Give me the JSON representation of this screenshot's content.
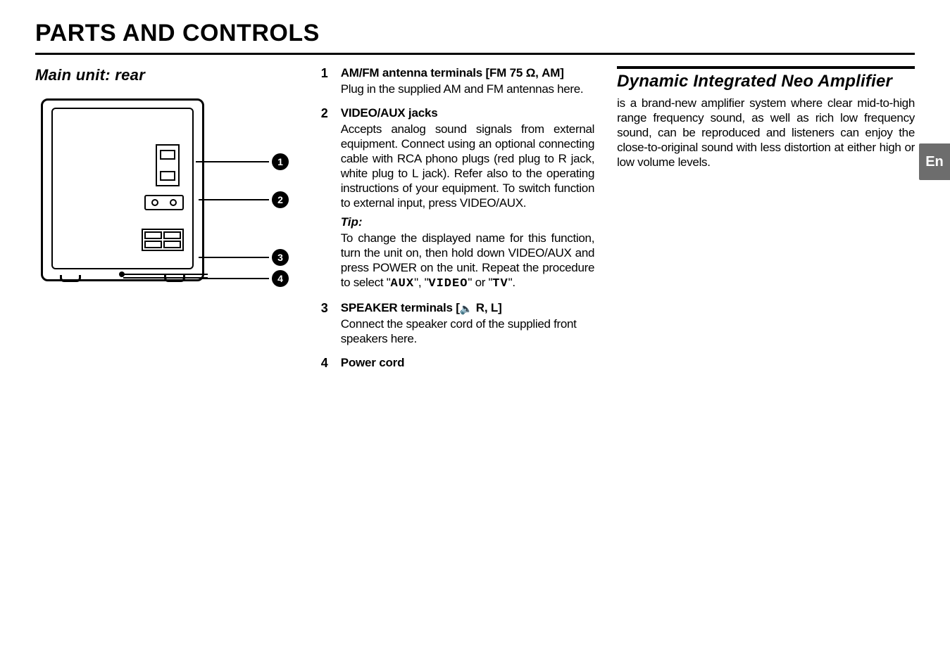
{
  "title": "PARTS AND CONTROLS",
  "langTab": "En",
  "left": {
    "subhead": "Main unit: rear",
    "callouts": [
      "1",
      "2",
      "3",
      "4"
    ]
  },
  "mid": {
    "items": [
      {
        "num": "1",
        "head_prefix": "AM/FM antenna terminals [FM 75 ",
        "head_ohm": "Ω",
        "head_suffix": ", AM]",
        "body": "Plug in the supplied AM and FM antennas here."
      },
      {
        "num": "2",
        "head": "VIDEO/AUX jacks",
        "body": "Accepts analog sound signals from external equipment. Connect using an optional connecting cable with RCA phono plugs (red plug to R jack, white plug to L jack). Refer also to the operating instructions of your equipment. To switch function to external input, press VIDEO/AUX.",
        "tip_head": "Tip:",
        "tip_body_pre": "To change the displayed name for this function, turn the unit on, then hold down VIDEO/AUX and press POWER on the unit. Repeat the procedure to select \"",
        "tip_aux": "AUX",
        "tip_mid1": "\", \"",
        "tip_video": "VIDEO",
        "tip_mid2": "\" or \"",
        "tip_tv": "TV",
        "tip_end": "\"."
      },
      {
        "num": "3",
        "head_prefix": "SPEAKER terminals [",
        "head_suffix": " R, L]",
        "body": "Connect the speaker cord of the supplied front speakers here."
      },
      {
        "num": "4",
        "head": "Power cord"
      }
    ]
  },
  "right": {
    "head": "Dynamic Integrated Neo Amplifier",
    "body": "is a brand-new amplifier system where clear mid-to-high range frequency sound, as well as rich low frequency sound, can be reproduced and listeners can enjoy the close-to-original sound with less distortion at either high or low volume levels."
  }
}
